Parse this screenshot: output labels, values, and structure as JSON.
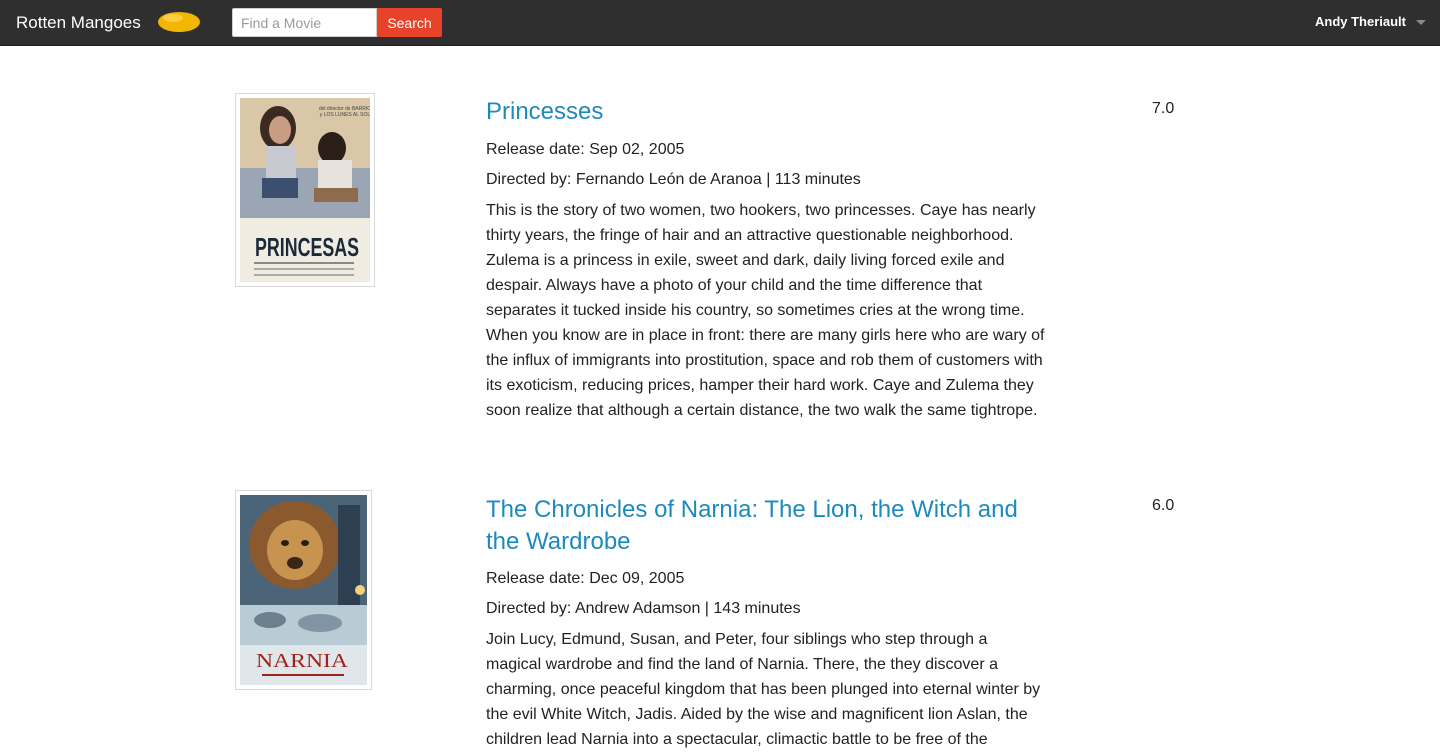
{
  "navbar": {
    "brand": "Rotten Mangoes",
    "logo_icon": "mango-icon",
    "search": {
      "placeholder": "Find a Movie",
      "value": "",
      "button_label": "Search"
    },
    "user": {
      "name": "Andy Theriault",
      "dropdown_icon": "caret-down-icon"
    }
  },
  "movies": [
    {
      "title": "Princesses",
      "release_label": "Release date:",
      "release_date": "Sep 02, 2005",
      "directed_label": "Directed by:",
      "director": "Fernando León de Aranoa",
      "runtime": "113 minutes",
      "description": "This is the story of two women, two hookers, two princesses. Caye has nearly thirty years, the fringe of hair and an attractive questionable neighborhood. Zulema is a princess in exile, sweet and dark, daily living forced exile and despair. Always have a photo of your child and the time difference that separates it tucked inside his country, so sometimes cries at the wrong time. When you know are in place in front: there are many girls here who are wary of the influx of immigrants into prostitution, space and rob them of customers with its exoticism, reducing prices, hamper their hard work. Caye and Zulema they soon realize that although a certain distance, the two walk the same tightrope.",
      "rating": "7.0",
      "poster_text": "PRINCESAS"
    },
    {
      "title": "The Chronicles of Narnia: The Lion, the Witch and the Wardrobe",
      "release_label": "Release date:",
      "release_date": "Dec 09, 2005",
      "directed_label": "Directed by:",
      "director": "Andrew Adamson",
      "runtime": "143 minutes",
      "description": "Join Lucy, Edmund, Susan, and Peter, four siblings who step through a magical wardrobe and find the land of Narnia. There, the they discover a charming, once peaceful kingdom that has been plunged into eternal winter by the evil White Witch, Jadis. Aided by the wise and magnificent lion Aslan, the children lead Narnia into a spectacular, climactic battle to be free of the",
      "rating": "6.0",
      "poster_text": "NARNIA"
    }
  ]
}
